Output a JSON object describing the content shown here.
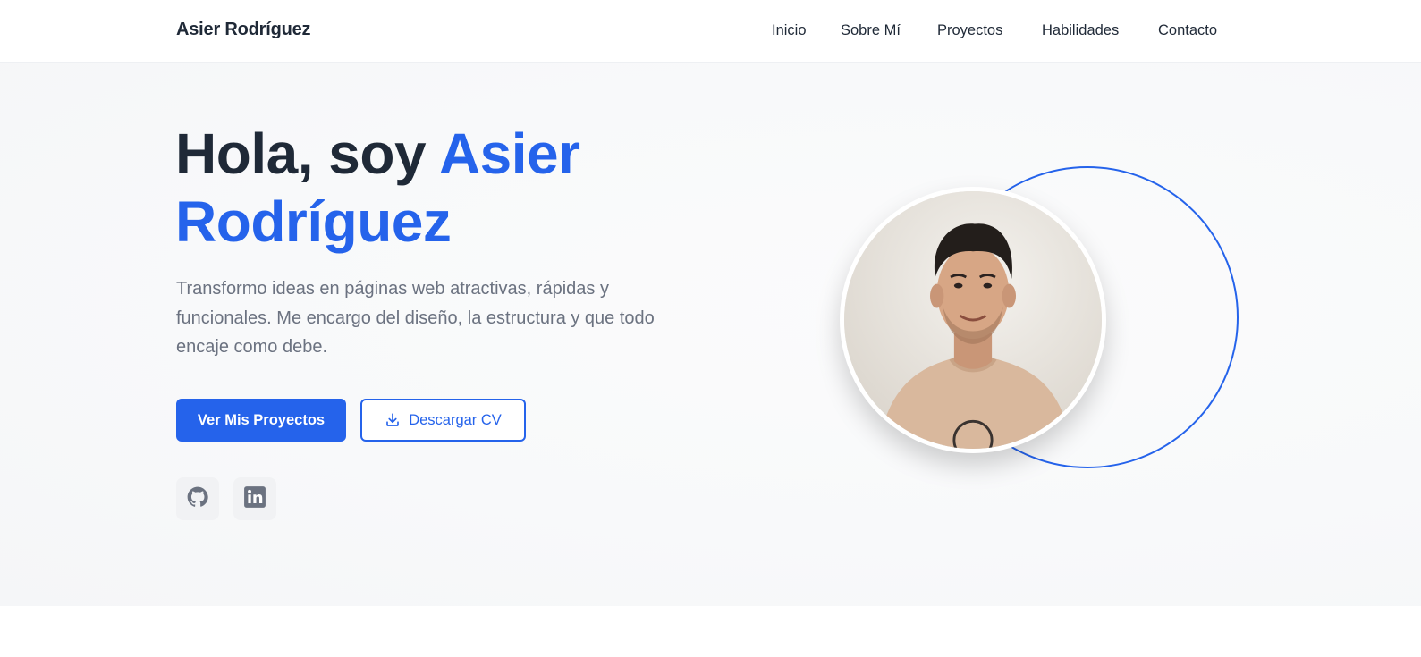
{
  "nav": {
    "brand": "Asier Rodríguez",
    "links": [
      "Inicio",
      "Sobre Mí",
      "Proyectos",
      "Habilidades",
      "Contacto"
    ]
  },
  "hero": {
    "greeting": "Hola, soy ",
    "name_line1": "Asier",
    "name_line2": "Rodríguez",
    "description": "Transformo ideas en páginas web atractivas, rápidas y funcionales. Me encargo del diseño, la estructura y que todo encaje como debe.",
    "primary_button": "Ver Mis Proyectos",
    "secondary_button": "Descargar CV",
    "socials": [
      {
        "icon": "github-icon"
      },
      {
        "icon": "linkedin-icon"
      }
    ],
    "profile_photo": "profile-photo"
  },
  "colors": {
    "accent": "#2563eb",
    "text_dark": "#1f2937",
    "text_muted": "#6b7280"
  }
}
